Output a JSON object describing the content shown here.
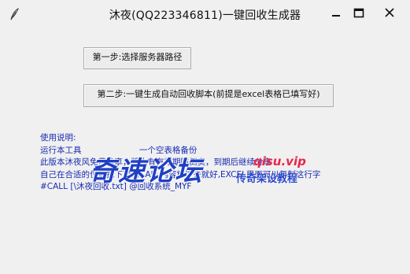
{
  "window": {
    "title": "沐夜(QQ223346811)一键回收生成器"
  },
  "buttons": {
    "step1": "第一步:选择服务器路径",
    "step2": "第二步:一键生成自动回收脚本(前提是excel表格已填写好)"
  },
  "instructions": {
    "heading": "使用说明:",
    "line1": "运行本工具                      一个空表格备份",
    "line2": "此版本沐夜风免费分享，版本有有效期防倒卖，到期后继续分享",
    "line3": "自己在合适的位置把下面的CALL内容放进去就好,EXCEL里面可以复制这行字",
    "line4": "#CALL [\\沐夜回收.txt] @回收系统_MYF"
  },
  "watermark": {
    "main": "奇速论坛",
    "site": "qisu.vip",
    "slogan": "传奇架设教程"
  },
  "colors": {
    "text_blue": "#1a2bb3",
    "watermark_blue": "#1f3fc4",
    "watermark_red": "#e8264a",
    "close_hover": "#e81123"
  }
}
